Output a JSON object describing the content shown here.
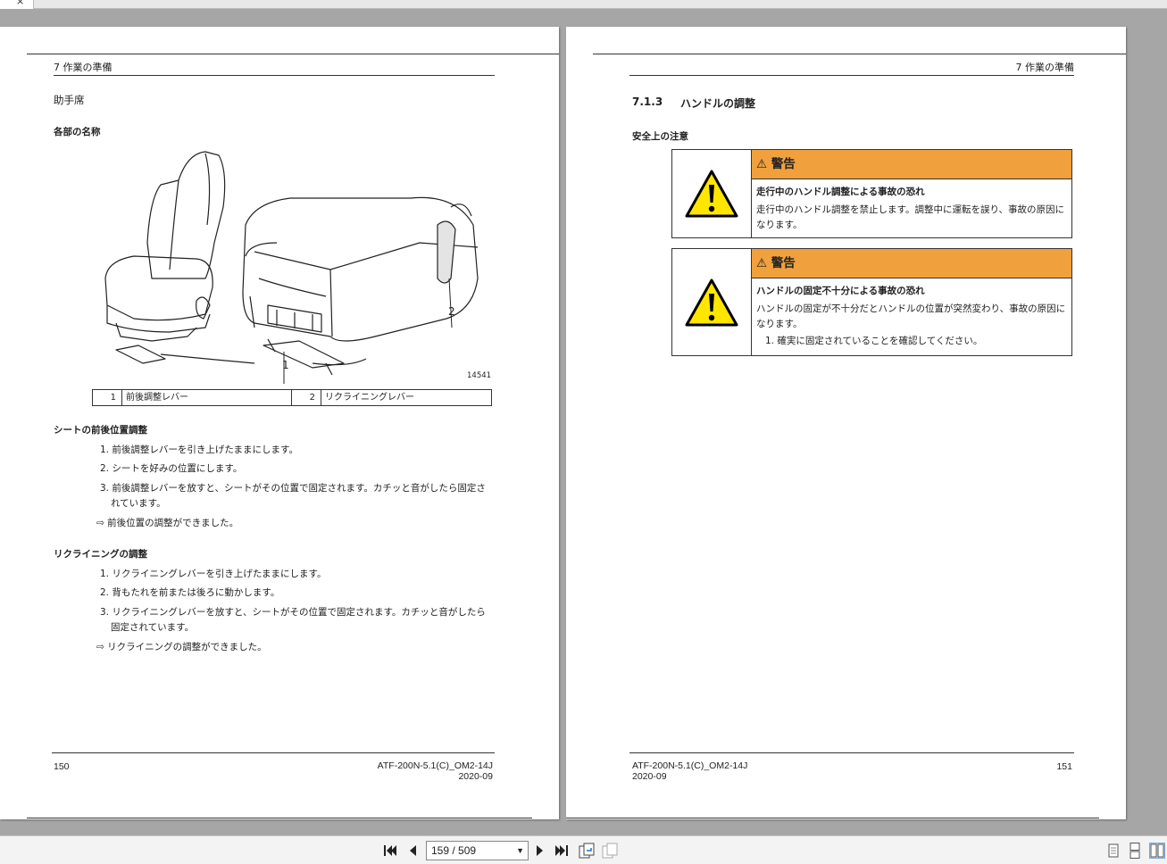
{
  "left_page": {
    "header": "7 作業の準備",
    "section": "助手席",
    "subsection": "各部の名称",
    "figure_id": "14541",
    "callouts": [
      "1",
      "2"
    ],
    "legend": [
      {
        "num": "1",
        "label": "前後調整レバー"
      },
      {
        "num": "2",
        "label": "リクライニングレバー"
      }
    ],
    "fore_aft": {
      "title": "シートの前後位置調整",
      "steps": [
        {
          "num": "1.",
          "text": "前後調整レバーを引き上げたままにします。"
        },
        {
          "num": "2.",
          "text": "シートを好みの位置にします。"
        },
        {
          "num": "3.",
          "text": "前後調整レバーを放すと、シートがその位置で固定されます。カチッと音がしたら固定さ",
          "text2": "れています。"
        }
      ],
      "result": "前後位置の調整ができました。"
    },
    "recline": {
      "title": "リクライニングの調整",
      "steps": [
        {
          "num": "1.",
          "text": "リクライニングレバーを引き上げたままにします。"
        },
        {
          "num": "2.",
          "text": "背もたれを前または後ろに動かします。"
        },
        {
          "num": "3.",
          "text": "リクライニングレバーを放すと、シートがその位置で固定されます。カチッと音がしたら",
          "text2": "固定されています。"
        }
      ],
      "result": "リクライニングの調整ができました。"
    },
    "result_arrow": "⇨",
    "footer": {
      "page_number": "150",
      "doc_id": "ATF-200N-5.1(C)_OM2-14J",
      "date": "2020-09"
    }
  },
  "right_page": {
    "header": "7 作業の準備",
    "section_number": "7.1.3",
    "section_title": "ハンドルの調整",
    "safety_heading": "安全上の注意",
    "warnings": [
      {
        "title": "⚠ 警告",
        "heading": "走行中のハンドル調整による事故の恐れ",
        "lines": [
          "走行中のハンドル調整を禁止します。調整中に運転を誤り、事故の原因に",
          "なります。"
        ],
        "step": ""
      },
      {
        "title": "⚠ 警告",
        "heading": "ハンドルの固定不十分による事故の恐れ",
        "lines": [
          "ハンドルの固定が不十分だとハンドルの位置が突然変わり、事故の原因に",
          "なります。"
        ],
        "step": "1. 確実に固定されていることを確認してください。"
      }
    ],
    "footer": {
      "page_number": "151",
      "doc_id": "ATF-200N-5.1(C)_OM2-14J",
      "date": "2020-09"
    }
  },
  "toolbar": {
    "page_display": "159 / 509",
    "icons": [
      "first-page-icon",
      "prev-page-icon",
      "next-page-icon",
      "last-page-icon",
      "rotate-icon",
      "copy-icon",
      "single-page-view-icon",
      "continuous-view-icon",
      "two-page-view-icon"
    ]
  },
  "colors": {
    "warning_orange": "#f0a03c",
    "warning_yellow": "#ffe600",
    "background": "#a6a6a6"
  }
}
